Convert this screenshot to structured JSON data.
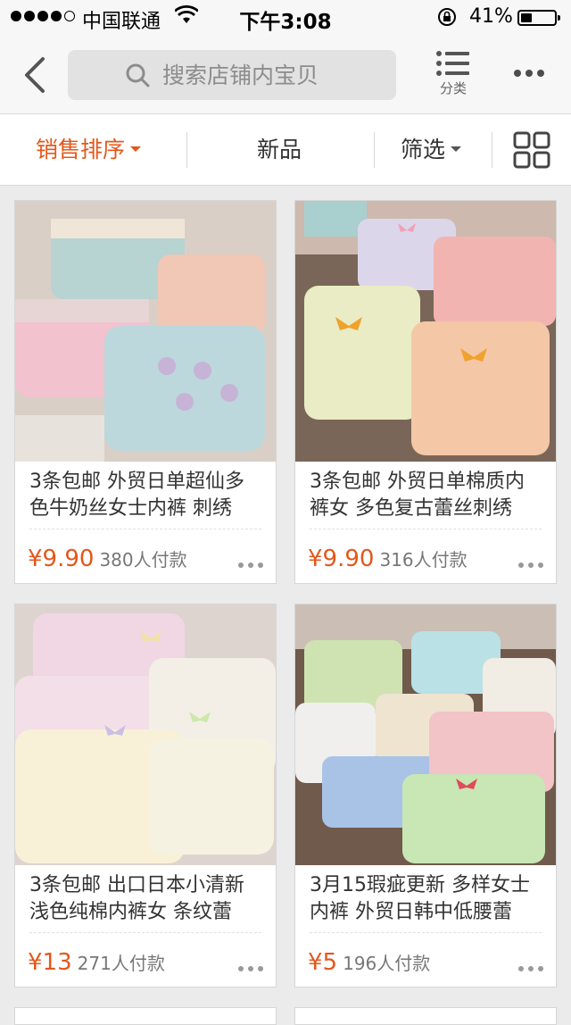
{
  "status": {
    "carrier": "中国联通",
    "time": "下午3:08",
    "battery_percent": "41%",
    "battery_level": 0.41
  },
  "nav": {
    "search_placeholder": "搜索店铺内宝贝",
    "category_label": "分类"
  },
  "filters": {
    "sales_sort": "销售排序",
    "new": "新品",
    "filter": "筛选",
    "accent_color": "#e4571b"
  },
  "products": [
    {
      "title": "3条包邮 外贸日单超仙多色牛奶丝女士内裤 刺绣",
      "price": "¥9.90",
      "sold": "380人付款"
    },
    {
      "title": "3条包邮 外贸日单棉质内裤女 多色复古蕾丝刺绣",
      "price": "¥9.90",
      "sold": "316人付款"
    },
    {
      "title": "3条包邮 出口日本小清新浅色纯棉内裤女 条纹蕾",
      "price": "¥13",
      "sold": "271人付款"
    },
    {
      "title": "3月15瑕疵更新 多样女士内裤 外贸日韩中低腰蕾",
      "price": "¥5",
      "sold": "196人付款"
    }
  ]
}
